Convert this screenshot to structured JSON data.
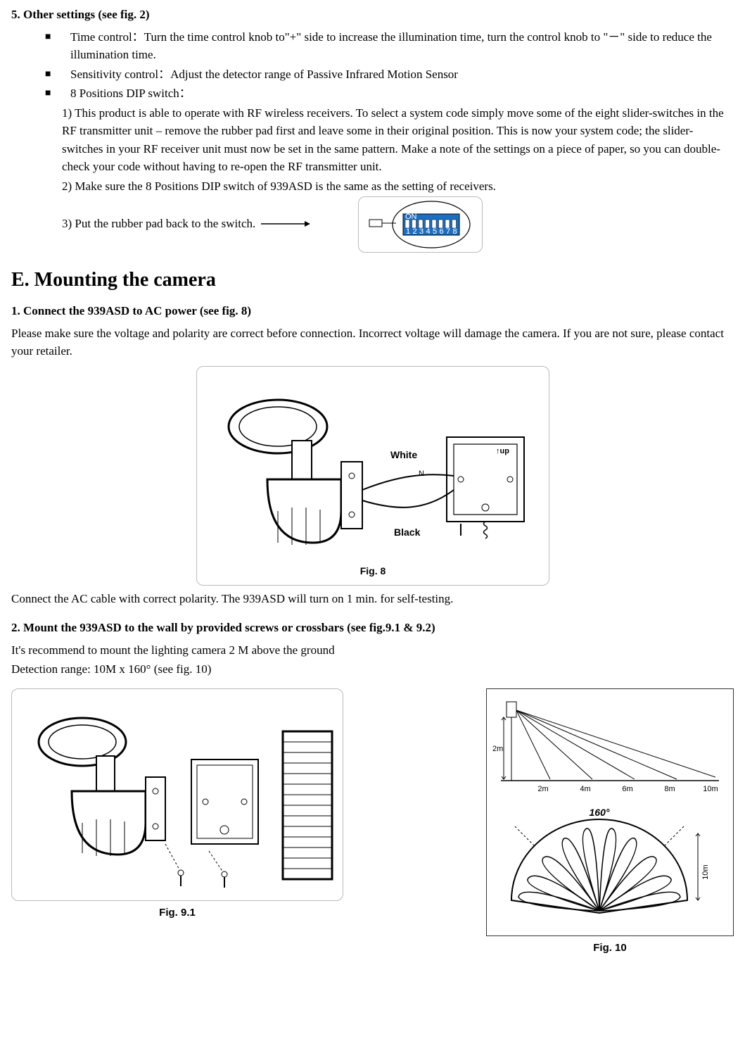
{
  "section5": {
    "heading": "5. Other settings (see fig. 2)",
    "bullets": [
      "Time control：Turn the time control knob to\"+\" side to increase the illumination time, turn the control knob to \"－\" side to reduce the illumination time.",
      "Sensitivity control：Adjust the detector range of Passive Infrared Motion Sensor",
      "8 Positions DIP switch："
    ],
    "dip1": "1) This product is able to operate with RF wireless receivers.    To select a system code simply move some of the eight slider-switches in the RF transmitter unit – remove the rubber pad first and leave some in their original position.    This is now your system code; the slider-switches in your RF receiver unit must now be set in the same pattern. Make a note of the settings on a piece of paper, so you can double-check your code without having to re-open the RF transmitter unit.",
    "dip2": "2) Make sure the 8 Positions DIP switch of 939ASD is the same as the setting of receivers.",
    "dip3": "3) Put the rubber pad back to the switch."
  },
  "sectionE": {
    "title": "E. Mounting the camera",
    "sub1_heading": "1. Connect the 939ASD to AC power (see fig. 8)",
    "sub1_body": "Please make sure the voltage and polarity are correct before connection. Incorrect voltage will damage the camera. If you are not sure, please contact your retailer.",
    "sub1_after": "Connect the AC cable with correct polarity. The 939ASD will turn on 1 min. for self-testing.",
    "sub2_heading": "2. Mount the 939ASD to the wall by provided screws or crossbars (see fig.9.1 & 9.2)",
    "sub2_l1": "It's recommend to mount the lighting camera 2 M above the ground",
    "sub2_l2": "Detection range: 10M x 160° (see fig. 10)"
  },
  "fig8": {
    "caption": "Fig. 8",
    "labels": {
      "white": "White",
      "black": "Black",
      "n": "N",
      "up": "up"
    }
  },
  "fig91": {
    "caption": "Fig. 9.1"
  },
  "fig10": {
    "caption": "Fig. 10",
    "labels": {
      "h2m": "2m",
      "d2m": "2m",
      "d4m": "4m",
      "d6m": "6m",
      "d8m": "8m",
      "d10m": "10m",
      "angle": "160°",
      "r10m": "10m"
    }
  },
  "dip_diagram": {
    "on": "ON",
    "nums": [
      "1",
      "2",
      "3",
      "4",
      "5",
      "6",
      "7",
      "8"
    ]
  }
}
